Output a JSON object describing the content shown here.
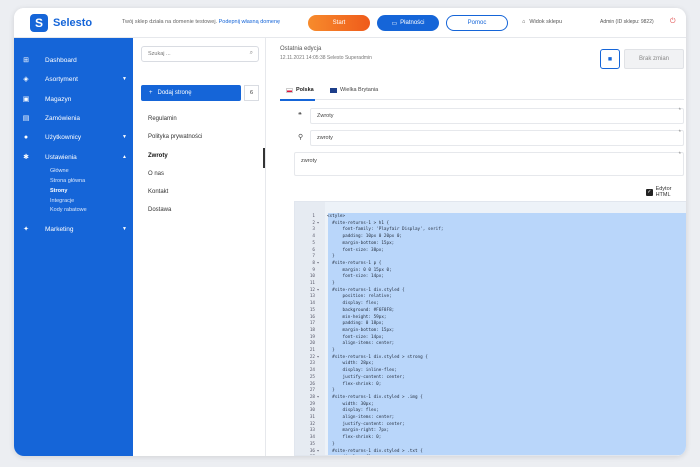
{
  "topbar": {
    "logo": "Selesto",
    "notice_text": "Twój sklep działa na domenie testowej.",
    "notice_link": "Podepnij własną domenę",
    "start_label": "Start",
    "payments_label": "Płatności",
    "help_label": "Pomoc",
    "shop_view_label": "Widok sklepu",
    "admin_label": "Admin (ID sklepu: 9822)"
  },
  "sidebar": {
    "items": [
      {
        "label": "Dashboard",
        "icon": "grid-icon"
      },
      {
        "label": "Asortyment",
        "icon": "tag-icon"
      },
      {
        "label": "Magazyn",
        "icon": "box-icon"
      },
      {
        "label": "Zamówienia",
        "icon": "cart-icon"
      },
      {
        "label": "Użytkownicy",
        "icon": "user-icon"
      },
      {
        "label": "Ustawienia",
        "icon": "gear-icon"
      },
      {
        "label": "Marketing",
        "icon": "megaphone-icon"
      }
    ],
    "subitems": [
      "Główne",
      "Strona główna",
      "Strony",
      "Integracje",
      "Kody rabatowe"
    ]
  },
  "list": {
    "search_placeholder": "Szukaj ...",
    "add_label": "Dodaj stronę",
    "add_count": "6",
    "pages": [
      "Regulamin",
      "Polityka prywatności",
      "Zwroty",
      "O nas",
      "Kontakt",
      "Dostawa"
    ]
  },
  "main": {
    "edit_title": "Ostatnia edycja",
    "edit_date": "12.11.2021  14:05:38   Selesto Superadmin",
    "no_changes_label": "Brak zmian",
    "tabs": [
      "Polska",
      "Wielka Brytania"
    ],
    "fields": {
      "title_value": "Zwroty",
      "slug_value": "zwroty",
      "desc_value": "zwroty"
    },
    "html_editor_label": "Edytor HTML",
    "code_lines": [
      {
        "n": "1",
        "f": "",
        "t": "<style>"
      },
      {
        "n": "2",
        "f": "▾",
        "t": "  #site-returns-1 > h1 {"
      },
      {
        "n": "3",
        "f": "",
        "t": "      font-family: 'Playfair Display', serif;"
      },
      {
        "n": "4",
        "f": "",
        "t": "      padding: 10px 0 20px 0;"
      },
      {
        "n": "5",
        "f": "",
        "t": "      margin-bottom: 15px;"
      },
      {
        "n": "6",
        "f": "",
        "t": "      font-size: 38px;"
      },
      {
        "n": "7",
        "f": "",
        "t": "  }"
      },
      {
        "n": "8",
        "f": "▾",
        "t": "  #site-returns-1 p {"
      },
      {
        "n": "9",
        "f": "",
        "t": "      margin: 0 0 15px 0;"
      },
      {
        "n": "10",
        "f": "",
        "t": "      font-size: 14px;"
      },
      {
        "n": "11",
        "f": "",
        "t": "  }"
      },
      {
        "n": "12",
        "f": "▾",
        "t": "  #site-returns-1 div.styled {"
      },
      {
        "n": "13",
        "f": "",
        "t": "      position: relative;"
      },
      {
        "n": "14",
        "f": "",
        "t": "      display: flex;"
      },
      {
        "n": "15",
        "f": "",
        "t": "      background: #F6F8F8;"
      },
      {
        "n": "16",
        "f": "",
        "t": "      min-height: 59px;"
      },
      {
        "n": "17",
        "f": "",
        "t": "      padding: 0 18px;"
      },
      {
        "n": "18",
        "f": "",
        "t": "      margin-bottom: 15px;"
      },
      {
        "n": "19",
        "f": "",
        "t": "      font-size: 14px;"
      },
      {
        "n": "20",
        "f": "",
        "t": "      align-items: center;"
      },
      {
        "n": "21",
        "f": "",
        "t": "  }"
      },
      {
        "n": "22",
        "f": "▾",
        "t": "  #site-returns-1 div.styled > strong {"
      },
      {
        "n": "23",
        "f": "",
        "t": "      width: 28px;"
      },
      {
        "n": "24",
        "f": "",
        "t": "      display: inline-flex;"
      },
      {
        "n": "25",
        "f": "",
        "t": "      justify-content: center;"
      },
      {
        "n": "26",
        "f": "",
        "t": "      flex-shrink: 0;"
      },
      {
        "n": "27",
        "f": "",
        "t": "  }"
      },
      {
        "n": "28",
        "f": "▾",
        "t": "  #site-returns-1 div.styled > .img {"
      },
      {
        "n": "29",
        "f": "",
        "t": "      width: 30px;"
      },
      {
        "n": "30",
        "f": "",
        "t": "      display: flex;"
      },
      {
        "n": "31",
        "f": "",
        "t": "      align-items: center;"
      },
      {
        "n": "32",
        "f": "",
        "t": "      justify-content: center;"
      },
      {
        "n": "33",
        "f": "",
        "t": "      margin-right: 7px;"
      },
      {
        "n": "34",
        "f": "",
        "t": "      flex-shrink: 0;"
      },
      {
        "n": "35",
        "f": "",
        "t": "  }"
      },
      {
        "n": "36",
        "f": "▾",
        "t": "  #site-returns-1 div.styled > .txt {"
      },
      {
        "n": "37",
        "f": "",
        "t": "      display: flex;"
      }
    ]
  },
  "colors": {
    "brand": "#1565d8",
    "start": "#f26a21",
    "selection": "#b9d6fa"
  }
}
